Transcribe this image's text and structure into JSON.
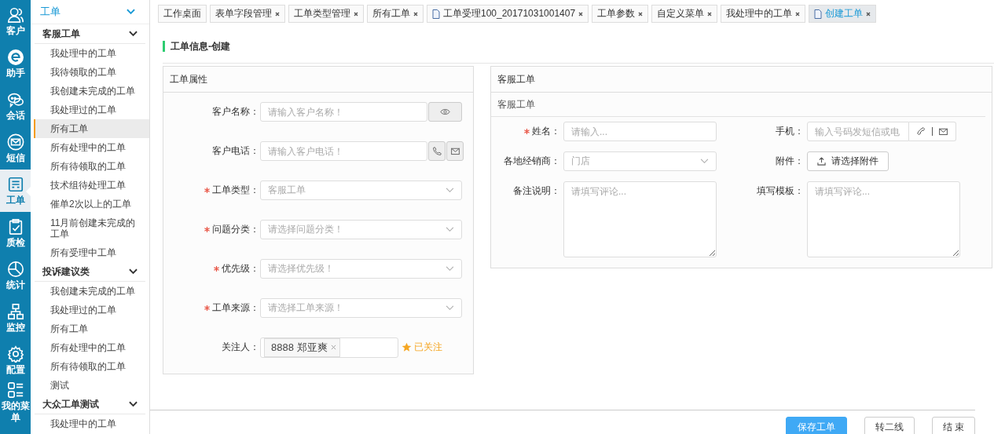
{
  "rail": [
    {
      "label": "客户",
      "selected": false
    },
    {
      "label": "助手",
      "selected": false
    },
    {
      "label": "会话",
      "selected": false
    },
    {
      "label": "短信",
      "selected": false
    },
    {
      "label": "工单",
      "selected": true
    },
    {
      "label": "质检",
      "selected": false
    },
    {
      "label": "统计",
      "selected": false
    },
    {
      "label": "监控",
      "selected": false
    },
    {
      "label": "配置",
      "selected": false
    },
    {
      "label": "我的菜单",
      "selected": false
    }
  ],
  "sidebar": {
    "header": "工单",
    "groups": [
      {
        "title": "客服工单",
        "expanded": true,
        "items": [
          {
            "label": "我处理中的工单",
            "selected": false
          },
          {
            "label": "我待领取的工单",
            "selected": false
          },
          {
            "label": "我创建未完成的工单",
            "selected": false
          },
          {
            "label": "我处理过的工单",
            "selected": false
          },
          {
            "label": "所有工单",
            "selected": true
          },
          {
            "label": "所有处理中的工单",
            "selected": false
          },
          {
            "label": "所有待领取的工单",
            "selected": false
          },
          {
            "label": "技术组待处理工单",
            "selected": false
          },
          {
            "label": "催单2次以上的工单",
            "selected": false
          },
          {
            "label": "11月前创建未完成的工单",
            "selected": false
          },
          {
            "label": "所有受理中工单",
            "selected": false
          }
        ]
      },
      {
        "title": "投诉建议类",
        "expanded": true,
        "items": [
          {
            "label": "我创建未完成的工单",
            "selected": false
          },
          {
            "label": "我处理过的工单",
            "selected": false
          },
          {
            "label": "所有工单",
            "selected": false
          },
          {
            "label": "所有处理中的工单",
            "selected": false
          },
          {
            "label": "所有待领取的工单",
            "selected": false
          },
          {
            "label": "测试",
            "selected": false
          }
        ]
      },
      {
        "title": "大众工单测试",
        "expanded": true,
        "items": [
          {
            "label": "我处理中的工单",
            "selected": false
          }
        ]
      }
    ]
  },
  "tabs": [
    {
      "label": "工作桌面",
      "closable": false,
      "document": false,
      "selected": false
    },
    {
      "label": "表单字段管理",
      "closable": true,
      "document": false,
      "selected": false
    },
    {
      "label": "工单类型管理",
      "closable": true,
      "document": false,
      "selected": false
    },
    {
      "label": "所有工单",
      "closable": true,
      "document": false,
      "selected": false
    },
    {
      "label": "工单受理100_20171031001407",
      "closable": true,
      "document": true,
      "selected": false
    },
    {
      "label": "工单参数",
      "closable": true,
      "document": false,
      "selected": false
    },
    {
      "label": "自定义菜单",
      "closable": true,
      "document": false,
      "selected": false
    },
    {
      "label": "我处理中的工单",
      "closable": true,
      "document": false,
      "selected": false
    },
    {
      "label": "创建工单",
      "closable": true,
      "document": true,
      "selected": true
    }
  ],
  "page_title": "工单信息-创建",
  "left_panel": {
    "title": "工单属性",
    "fields": [
      {
        "label": "客户名称：",
        "required": false,
        "kind": "viewable",
        "placeholder": "请输入客户名称！"
      },
      {
        "label": "客户电话：",
        "required": false,
        "kind": "contact",
        "placeholder": "请输入客户电话！"
      },
      {
        "label": "工单类型：",
        "required": true,
        "kind": "select",
        "placeholder": "客服工单"
      },
      {
        "label": "问题分类：",
        "required": true,
        "kind": "select",
        "placeholder": "请选择问题分类！"
      },
      {
        "label": "优先级：",
        "required": true,
        "kind": "select",
        "placeholder": "请选择优先级！"
      },
      {
        "label": "工单来源：",
        "required": true,
        "kind": "select",
        "placeholder": "请选择工单来源！"
      },
      {
        "label": "关注人：",
        "required": false,
        "kind": "tags",
        "tags": [
          "8888 郑亚爽"
        ],
        "followed": true,
        "follow_text": "已关注"
      }
    ]
  },
  "right_panel": {
    "title": "客服工单",
    "subtitle": "客服工单",
    "fields": [
      {
        "label": "姓名：",
        "required": true,
        "kind": "text",
        "placeholder": "请输入..."
      },
      {
        "label": "手机：",
        "required": false,
        "kind": "phone",
        "placeholder": "输入号码发短信或电"
      },
      {
        "label": "各地经销商：",
        "required": false,
        "kind": "select",
        "placeholder": "门店"
      },
      {
        "label": "附件：",
        "required": false,
        "kind": "upload",
        "button": "请选择附件"
      },
      {
        "label": "备注说明：",
        "required": false,
        "kind": "textarea",
        "placeholder": "请填写评论..."
      },
      {
        "label": "填写模板：",
        "required": false,
        "kind": "textarea",
        "placeholder": "请填写评论..."
      }
    ]
  },
  "buttons": [
    {
      "label": "保存工单",
      "primary": true
    },
    {
      "label": "转二线",
      "primary": false
    },
    {
      "label": "结 束",
      "primary": false
    }
  ]
}
